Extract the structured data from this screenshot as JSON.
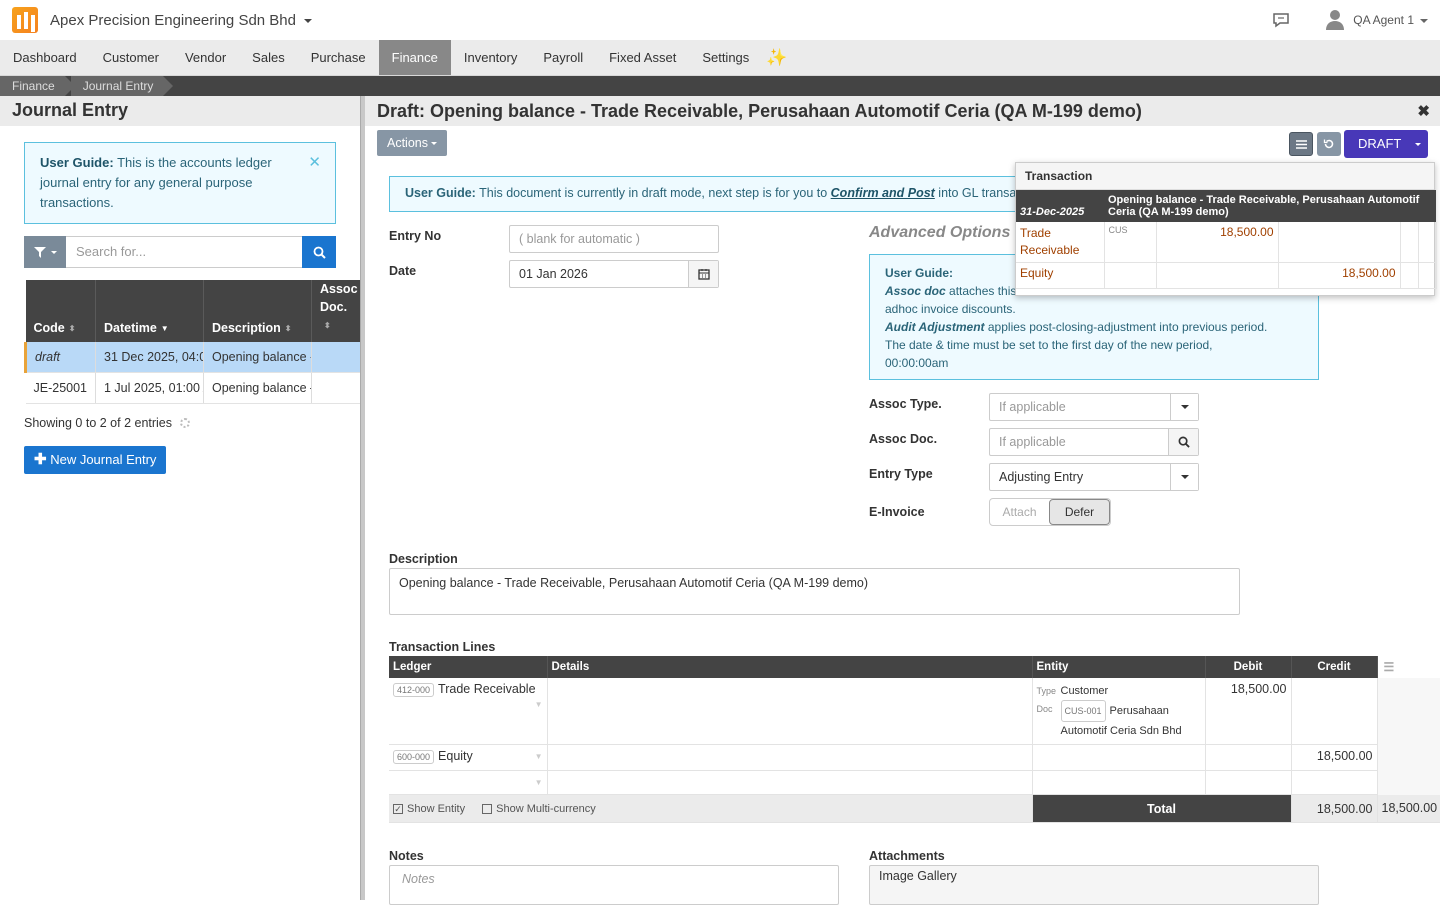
{
  "topbar": {
    "company": "Apex Precision Engineering Sdn Bhd",
    "user": "QA Agent 1"
  },
  "nav": {
    "items": [
      "Dashboard",
      "Customer",
      "Vendor",
      "Sales",
      "Purchase",
      "Finance",
      "Inventory",
      "Payroll",
      "Fixed Asset",
      "Settings"
    ],
    "active": "Finance"
  },
  "breadcrumb": [
    "Finance",
    "Journal Entry"
  ],
  "left": {
    "title": "Journal Entry",
    "guide_bold": "User Guide:",
    "guide_text": " This is the accounts ledger journal entry for any general purpose transactions.",
    "search_placeholder": "Search for...",
    "columns": [
      "Code",
      "Datetime",
      "Description",
      "Assoc Doc."
    ],
    "rows": [
      {
        "code": "draft",
        "datetime": "31 Dec 2025, 04:0",
        "description": "Opening balance -",
        "assoc": ""
      },
      {
        "code": "JE-25001",
        "datetime": "1 Jul 2025, 01:00 A",
        "description": "Opening balance –",
        "assoc": ""
      }
    ],
    "showing": "Showing 0 to 2 of 2 entries",
    "new_button": "New Journal Entry"
  },
  "right": {
    "title": "Draft: Opening balance - Trade Receivable, Perusahaan Automotif Ceria (QA M-199 demo)",
    "actions_label": "Actions",
    "status_button": "DRAFT",
    "guide_bold": "User Guide:",
    "guide_pre": " This document is currently in draft mode, next step is for you to ",
    "guide_link": "Confirm and Post",
    "guide_post": " into GL transactions.",
    "entry_no_label": "Entry No",
    "entry_no_placeholder": "( blank for automatic )",
    "date_label": "Date",
    "date_value": "01 Jan 2026",
    "advanced_title": "Advanced Options",
    "adv_guide_bold": "User Guide:",
    "adv_line1_em": "Assoc doc",
    "adv_line1": " attaches this",
    "adv_line2": "adhoc invoice discounts.",
    "adv_line3_em": "Audit Adjustment",
    "adv_line3": " applies post-closing-adjustment into previous period.",
    "adv_line4": "The date & time must be set to the first day of the new period,",
    "adv_line5": "00:00:00am",
    "assoc_type_label": "Assoc Type.",
    "assoc_type_placeholder": "If applicable",
    "assoc_doc_label": "Assoc Doc.",
    "assoc_doc_placeholder": "If applicable",
    "entry_type_label": "Entry Type",
    "entry_type_value": "Adjusting Entry",
    "einvoice_label": "E-Invoice",
    "einvoice_attach": "Attach",
    "einvoice_defer": "Defer",
    "description_label": "Description",
    "description_value": "Opening balance - Trade Receivable, Perusahaan Automotif Ceria (QA M-199 demo)",
    "lines_label": "Transaction Lines",
    "lines_columns": [
      "Ledger",
      "Details",
      "Entity",
      "Debit",
      "Credit"
    ],
    "lines": [
      {
        "code": "412-000",
        "ledger": "Trade Receivable",
        "type_label": "Type",
        "type": "Customer",
        "doc_label": "Doc",
        "doc_code": "CUS-001",
        "doc_name": "Perusahaan Automotif Ceria Sdn Bhd",
        "debit": "18,500.00",
        "credit": ""
      },
      {
        "code": "600-000",
        "ledger": "Equity",
        "debit": "",
        "credit": "18,500.00"
      }
    ],
    "show_entity": "Show Entity",
    "show_multicurrency": "Show Multi-currency",
    "total_label": "Total",
    "total_debit": "18,500.00",
    "total_credit": "18,500.00",
    "notes_label": "Notes",
    "notes_placeholder": "Notes",
    "attachments_label": "Attachments",
    "gallery_label": "Image Gallery"
  },
  "popover": {
    "title": "Transaction",
    "date": "31-Dec-2025",
    "description": "Opening balance - Trade Receivable, Perusahaan Automotif Ceria (QA M-199 demo)",
    "rows": [
      {
        "ledger": "Trade Receivable",
        "tag": "CUS",
        "debit": "18,500.00",
        "credit": ""
      },
      {
        "ledger": "Equity",
        "tag": "",
        "debit": "",
        "credit": "18,500.00"
      }
    ]
  }
}
